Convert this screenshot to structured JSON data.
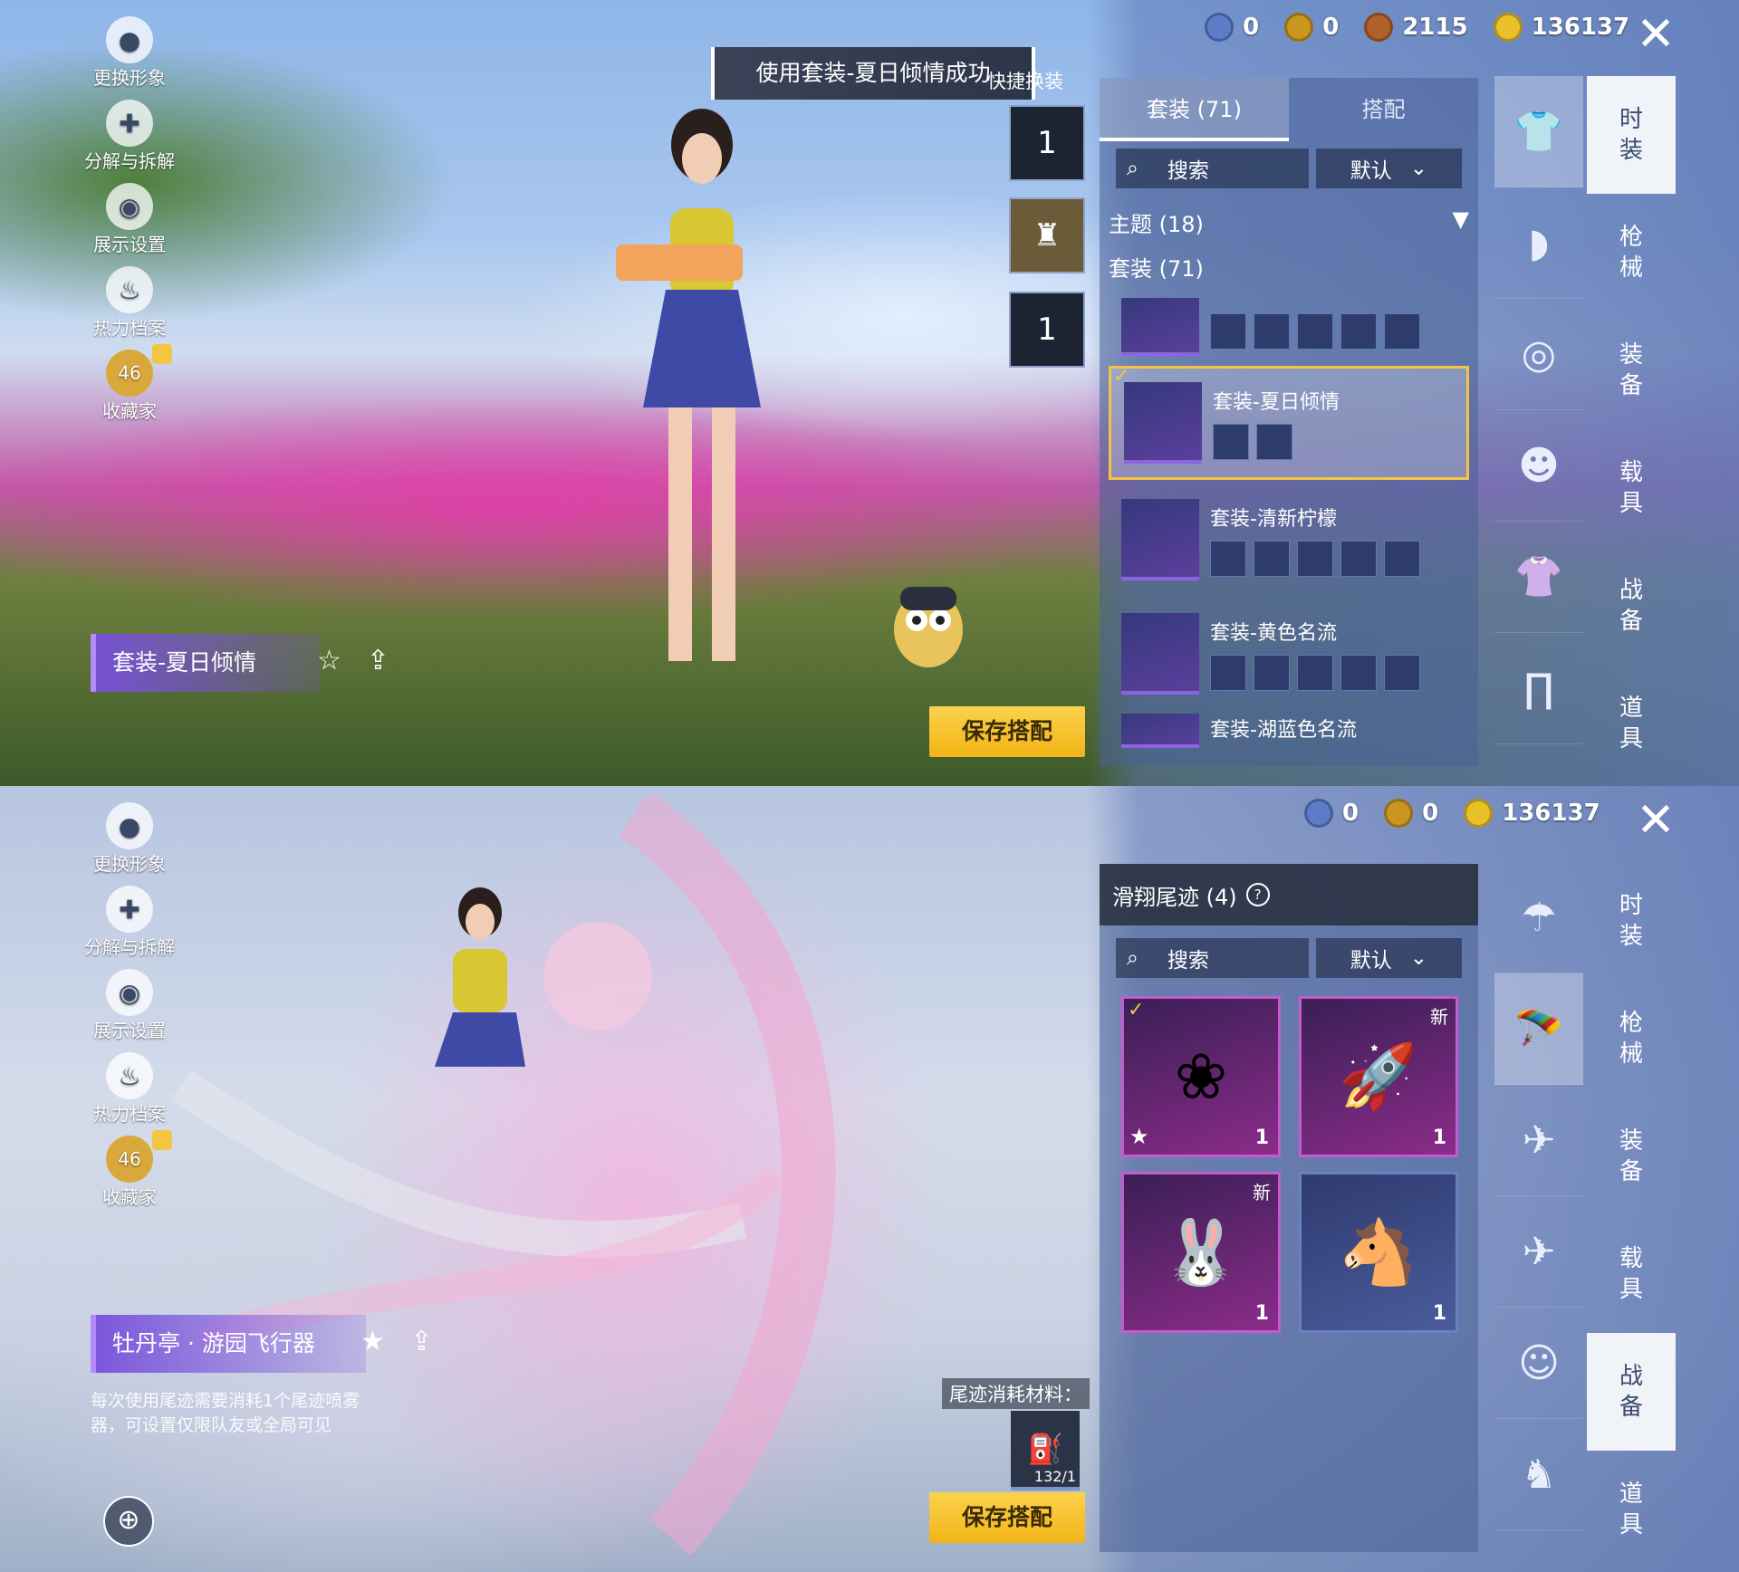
{
  "left_menu": [
    {
      "label": "更换形象",
      "icon": "person-icon"
    },
    {
      "label": "分解与拆解",
      "icon": "puzzle-icon"
    },
    {
      "label": "展示设置",
      "icon": "eye-icon"
    },
    {
      "label": "热力档案",
      "icon": "flame-icon"
    },
    {
      "label": "收藏家",
      "icon": "collector-badge-icon",
      "level": "46"
    }
  ],
  "currency_top": [
    "0",
    "0",
    "2115",
    "136137"
  ],
  "currency_bottom": [
    "0",
    "0",
    "136137"
  ],
  "nav": [
    {
      "label": "时装"
    },
    {
      "label": "枪械"
    },
    {
      "label": "装备"
    },
    {
      "label": "载具"
    },
    {
      "label": "战备"
    },
    {
      "label": "道具"
    }
  ],
  "top": {
    "toast": "使用套装-夏日倾情成功",
    "quick_label": "快捷换装",
    "hanger_num": "1",
    "tabs": [
      "套装 (71)",
      "搭配"
    ],
    "search_label": "搜索",
    "sort_label": "默认",
    "theme_row": "主题 (18)",
    "outfit_row": "套装 (71)",
    "outfits": [
      {
        "name": "套装-夏日倾情"
      },
      {
        "name": "套装-清新柠檬"
      },
      {
        "name": "套装-黄色名流"
      },
      {
        "name": "套装-湖蓝色名流"
      }
    ],
    "current_item": "套装-夏日倾情",
    "save_label": "保存搭配"
  },
  "bottom": {
    "section_title": "滑翔尾迹 (4)",
    "search_label": "搜索",
    "sort_label": "默认",
    "new_label": "新",
    "cell_count": "1",
    "current_item": "牡丹亭 · 游园飞行器",
    "description": "每次使用尾迹需要消耗1个尾迹喷雾器，可设置仅限队友或全局可见",
    "material_label": "尾迹消耗材料：",
    "material_count": "132/1",
    "save_label": "保存搭配"
  },
  "colors": {
    "accent_gold": "#f3c443",
    "panel_blue": "#5f78b4",
    "item_purple": "#8b2c8a"
  }
}
